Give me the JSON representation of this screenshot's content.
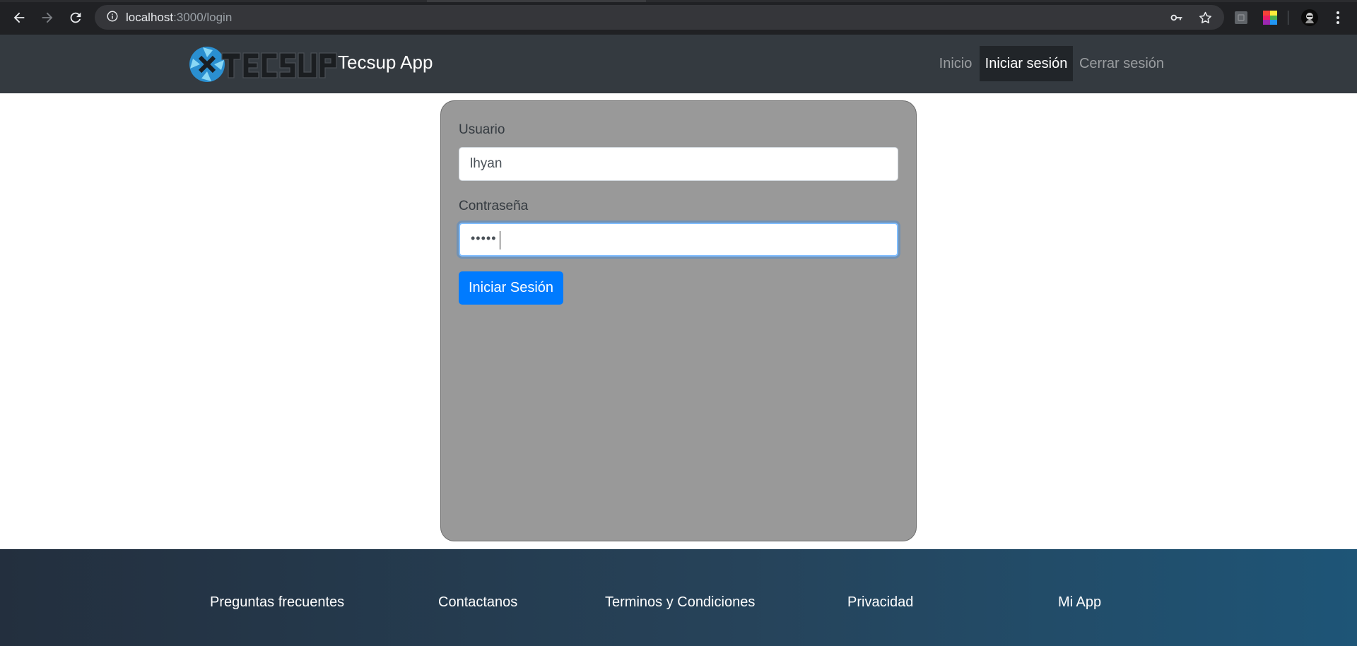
{
  "browser": {
    "url_host": "localhost",
    "url_path": ":3000/login"
  },
  "navbar": {
    "brand_title": "Tecsup App",
    "items": [
      {
        "label": "Inicio",
        "active": false
      },
      {
        "label": "Iniciar sesión",
        "active": true
      },
      {
        "label": "Cerrar sesión",
        "active": false
      }
    ]
  },
  "login_form": {
    "username_label": "Usuario",
    "username_value": "lhyan",
    "password_label": "Contraseña",
    "password_mask": "•••••",
    "submit_label": "Iniciar Sesión"
  },
  "footer": {
    "links": [
      "Preguntas frecuentes",
      "Contactanos",
      "Terminos y Condiciones",
      "Privacidad",
      "Mi App"
    ]
  },
  "colors": {
    "navbar_bg": "#343a40",
    "card_bg": "#999999",
    "primary": "#007bff",
    "footer_gradient_start": "#232f3e",
    "footer_gradient_end": "#1e5577"
  },
  "icons": [
    "back-arrow-icon",
    "forward-arrow-icon",
    "reload-icon",
    "info-icon",
    "key-icon",
    "star-icon",
    "extension-icon",
    "color-palette-icon",
    "profile-avatar",
    "kebab-menu-icon",
    "tecsup-logo"
  ]
}
